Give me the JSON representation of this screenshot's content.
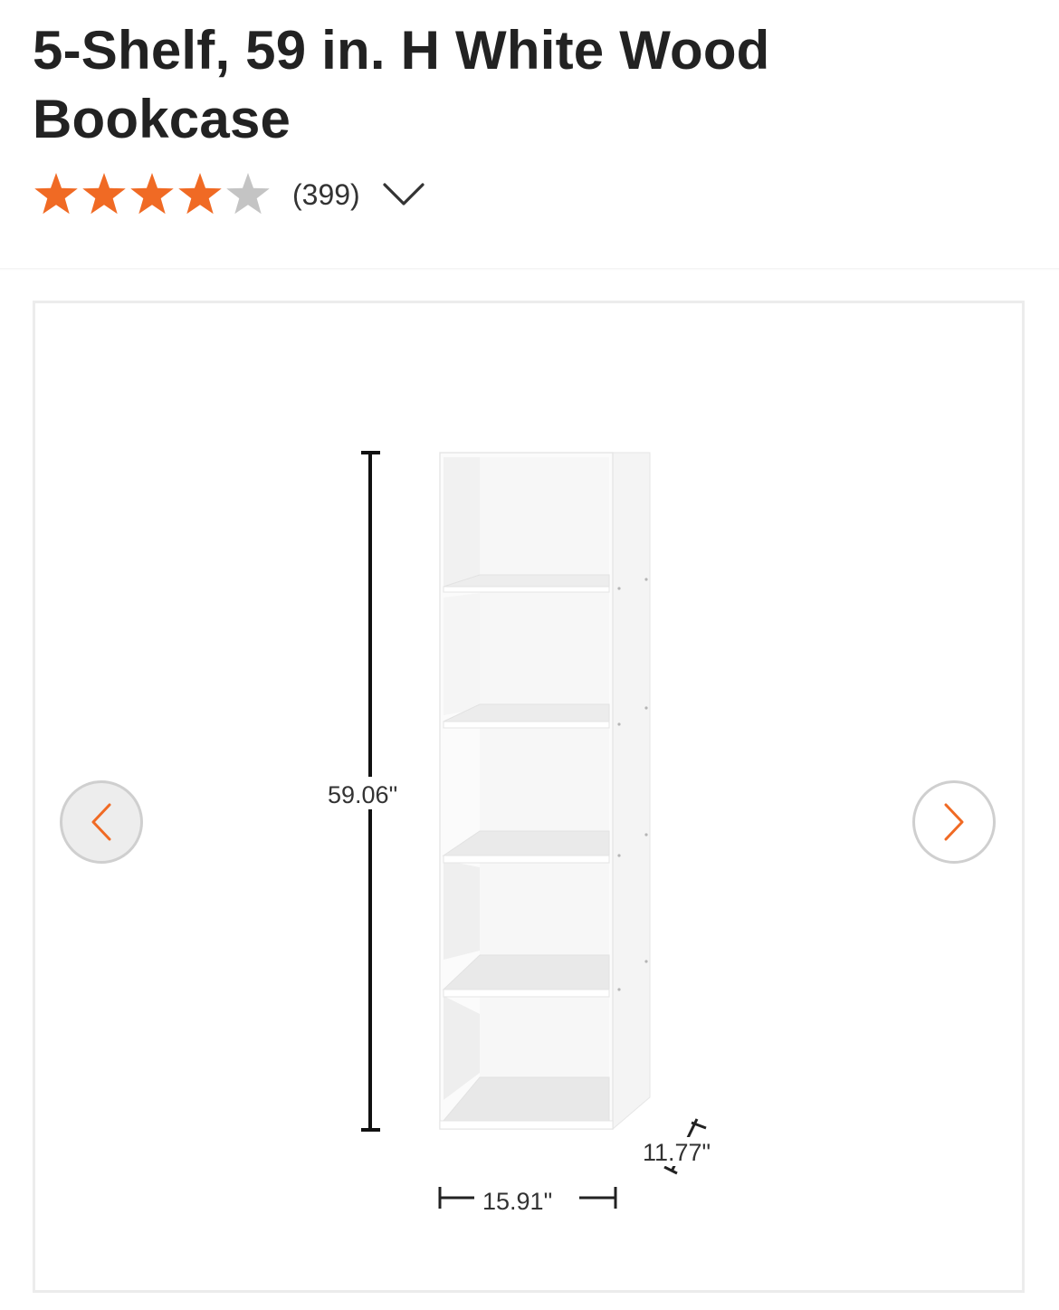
{
  "product": {
    "title": "5-Shelf, 59 in. H White Wood Bookcase",
    "rating": 4,
    "rating_max": 5,
    "review_count": "(399)"
  },
  "colors": {
    "star_filled": "#f06a24",
    "star_empty": "#c4c4c4",
    "nav_arrow": "#f06a24"
  },
  "icons": {
    "expand": "chevron-down-icon",
    "previous": "chevron-left-icon",
    "next": "chevron-right-icon"
  },
  "gallery": {
    "image_subject": "white five-shelf bookcase with dimension lines",
    "dimensions": {
      "height": "59.06\"",
      "width": "15.91\"",
      "depth": "11.77\""
    }
  }
}
